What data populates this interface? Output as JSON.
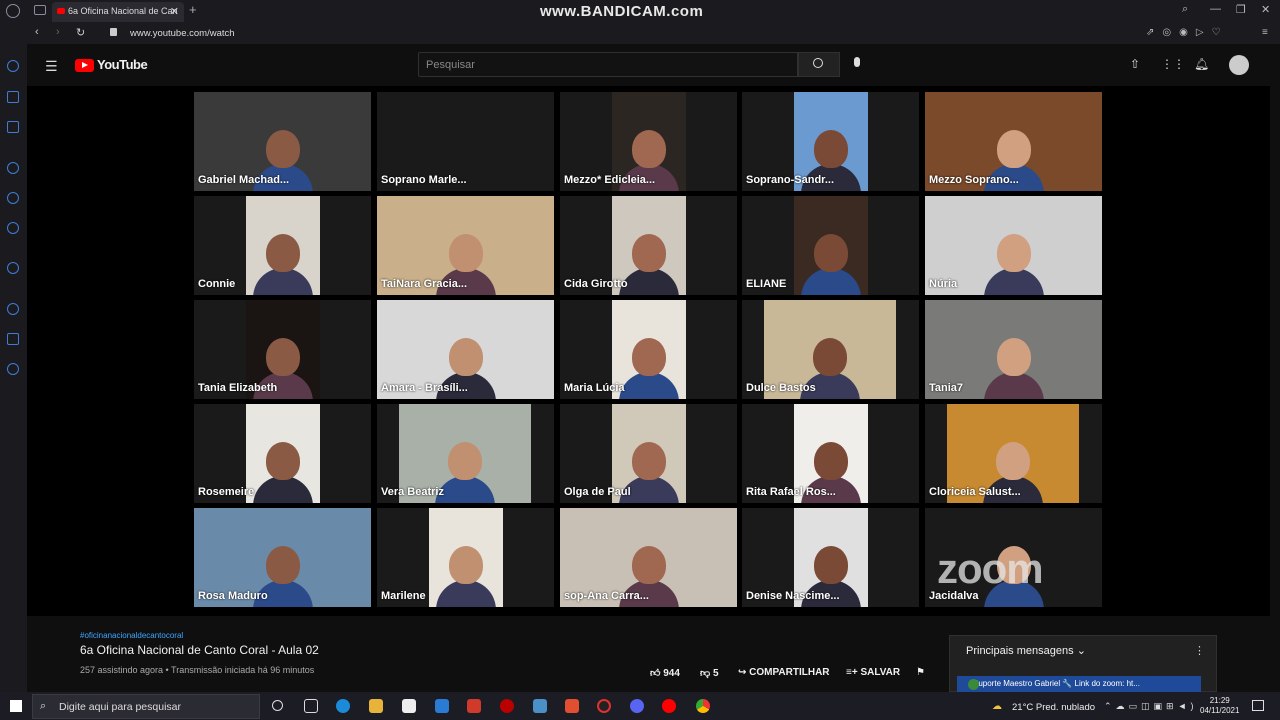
{
  "browser": {
    "tab_title": "6a Oficina Nacional de Can",
    "url": "www.youtube.com/watch",
    "watermark": "www.BANDICAM.com"
  },
  "youtube": {
    "logo": "YouTube",
    "search_placeholder": "Pesquisar"
  },
  "participants": [
    {
      "name": "Gabriel Machad...",
      "active": true
    },
    {
      "name": "Soprano Marle..."
    },
    {
      "name": "Mezzo* Edicleia..."
    },
    {
      "name": "Soprano-Sandr..."
    },
    {
      "name": "Mezzo Soprano..."
    },
    {
      "name": "Connie"
    },
    {
      "name": "TaiNara Gracia..."
    },
    {
      "name": "Cida Girotto"
    },
    {
      "name": "ELIANE"
    },
    {
      "name": "Núria"
    },
    {
      "name": "Tania Elizabeth"
    },
    {
      "name": "Amara - Brasíli..."
    },
    {
      "name": "Maria Lúcia"
    },
    {
      "name": "Dulce Bastos"
    },
    {
      "name": "Tania7"
    },
    {
      "name": "Rosemeire"
    },
    {
      "name": "Vera Beatriz"
    },
    {
      "name": "Olga de Paul"
    },
    {
      "name": "Rita Rafael Ros..."
    },
    {
      "name": "Cloriceia Salust..."
    },
    {
      "name": "Rosa Maduro"
    },
    {
      "name": "Marilene"
    },
    {
      "name": "sop-Ana Carra..."
    },
    {
      "name": "Denise Nascime..."
    },
    {
      "name": "Jacidalva"
    }
  ],
  "zoom_logo": "zoom",
  "video": {
    "hashtag": "#oficinanacionaldecantocoral",
    "title": "6a Oficina Nacional de Canto Coral - Aula 02",
    "meta": "257 assistindo agora • Transmissão iniciada há 96 minutos",
    "likes": "944",
    "dislikes": "5",
    "share_label": "COMPARTILHAR",
    "save_label": "SALVAR"
  },
  "chat": {
    "header": "Principais mensagens",
    "pinned": "Suporte Maestro Gabriel 🔧  Link do zoom: ht..."
  },
  "taskbar": {
    "search_placeholder": "Digite aqui para pesquisar",
    "weather": "21°C  Pred. nublado",
    "time": "21:29",
    "date": "04/11/2021"
  },
  "colors": {
    "active_speaker": "#7bd03a",
    "youtube_red": "#ff0000",
    "link_blue": "#3ea6ff"
  }
}
